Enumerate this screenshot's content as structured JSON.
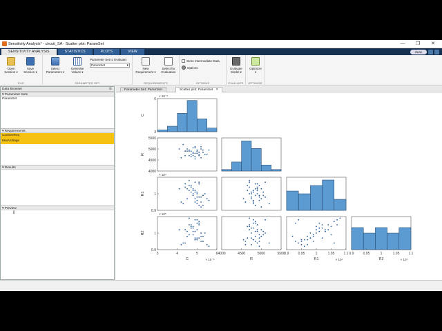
{
  "window": {
    "title": "Sensitivity Analysis* - circuit_SA - Scatter plot: ParamSet",
    "minimize_glyph": "—",
    "restore_glyph": "❐",
    "close_glyph": "✕"
  },
  "toolstrip_tabs": [
    {
      "label": "SENSITIVITY ANALYSIS",
      "active": true
    },
    {
      "label": "STATISTICS",
      "active": false
    },
    {
      "label": "PLOTS",
      "active": false
    },
    {
      "label": "VIEW",
      "active": false
    }
  ],
  "quick_access": {
    "chip_label": "clean"
  },
  "ribbon": {
    "file": {
      "group_name": "FILE",
      "open_label_1": "Open",
      "open_label_2": "Session ▾",
      "save_label_1": "Save",
      "save_label_2": "Session ▾"
    },
    "parameter_set": {
      "group_name": "PARAMETER SET",
      "select_params_1": "Select",
      "select_params_2": "Parameters ▾",
      "generate_values_1": "Generate",
      "generate_values_2": "Values ▾",
      "selector_label": "Parameter Set to Evaluate:",
      "selector_value": "ParamSet"
    },
    "requirements": {
      "group_name": "REQUIREMENTS",
      "new_req_1": "New",
      "new_req_2": "Requirement ▾",
      "select_eval_1": "Select for",
      "select_eval_2": "Evaluation"
    },
    "options": {
      "group_name": "OPTIONS",
      "store_label": "Store Intermediate Data",
      "options_label": "Options"
    },
    "evaluate": {
      "group_name": "EVALUATE",
      "eval_1": "Evaluate",
      "eval_2": "Model ▾"
    },
    "optimize": {
      "group_name": "OPTIMIZE",
      "opt_1": "Optimize",
      "opt_2": "▾"
    }
  },
  "data_browser": {
    "title": "Data Browser",
    "parameter_sets_header": "Parameter Sets",
    "parameter_sets": [
      "ParamSet"
    ],
    "requirements_header": "Requirements",
    "requirements": [
      "CustomReq",
      "MaxVoltage"
    ],
    "results_header": "Results",
    "preview_header": "Preview",
    "preview_value": "[]"
  },
  "doc_tabs": [
    {
      "label": "Parameter Set: ParamSet",
      "active": false
    },
    {
      "label": "Scatter plot: ParamSet",
      "active": true
    }
  ],
  "chart_data": {
    "type": "scatter",
    "variables": [
      "C",
      "R",
      "R1",
      "R2"
    ],
    "grid": false,
    "multipliers": {
      "C": "× 10⁻⁸",
      "R1": "× 10⁴",
      "R2": "× 10⁵"
    },
    "C_values": [
      4.2,
      4.6,
      5.1,
      4.9,
      5.3,
      4.4,
      4.8,
      5.0,
      5.6,
      4.7,
      5.2,
      4.5,
      4.9,
      5.1,
      5.4,
      4.3,
      4.8,
      5.0,
      4.6,
      5.2,
      4.9,
      5.3,
      4.7,
      5.5,
      4.1,
      5.0,
      4.8,
      4.6,
      5.1,
      4.9,
      5.2,
      4.4,
      5.0,
      4.7,
      5.3,
      4.8,
      4.5,
      5.1,
      4.9,
      5.0
    ],
    "R_values": [
      4600,
      4900,
      4750,
      5100,
      4850,
      4700,
      5050,
      4800,
      4950,
      4650,
      5000,
      4900,
      4550,
      4850,
      4750,
      5200,
      4800,
      4950,
      4700,
      4600,
      5050,
      4850,
      4900,
      4750,
      5000,
      4800,
      4700,
      4950,
      4850,
      4650,
      5100,
      4900,
      4800,
      4750,
      4950,
      4850,
      5000,
      4700,
      4800,
      4900
    ],
    "R1_values": [
      0.95,
      1.02,
      0.98,
      1.07,
      0.93,
      1.04,
      0.99,
      1.01,
      0.96,
      1.05,
      0.92,
      1.03,
      0.97,
      1.06,
      1.0,
      0.94,
      1.02,
      0.98,
      1.08,
      0.95,
      1.01,
      0.99,
      1.04,
      0.97,
      1.03,
      0.96,
      1.0,
      1.05,
      0.93,
      1.02,
      0.98,
      1.06,
      0.94,
      1.01,
      0.99,
      1.03,
      0.97,
      1.07,
      0.95,
      1.0
    ],
    "R2_values": [
      0.93,
      1.05,
      0.97,
      1.08,
      0.95,
      1.02,
      0.99,
      1.06,
      0.92,
      1.04,
      0.98,
      1.01,
      0.96,
      1.07,
      1.0,
      0.94,
      1.03,
      0.97,
      1.09,
      0.95,
      1.01,
      0.98,
      1.05,
      0.93,
      1.02,
      0.96,
      1.04,
      0.99,
      1.06,
      0.97,
      1.0,
      0.94,
      1.08,
      1.03,
      0.95,
      1.01,
      0.98,
      1.05,
      0.96,
      1.02
    ],
    "axes": {
      "C": {
        "range": [
          3,
          6
        ],
        "ticks": [
          3,
          4,
          5,
          6
        ],
        "hist_ticks": [
          3,
          4,
          5,
          6
        ]
      },
      "R": {
        "range": [
          4000,
          5500
        ],
        "ticks": [
          4000,
          4500,
          5000,
          5500
        ]
      },
      "R1": {
        "range": [
          0.9,
          1.1
        ],
        "ticks": [
          0.9,
          0.95,
          1,
          1.05,
          1.1
        ]
      },
      "R2": {
        "range": [
          0.9,
          1.1
        ],
        "ticks": [
          0.9,
          0.95,
          1,
          1.05,
          1.1
        ]
      }
    },
    "histograms": {
      "C": {
        "edges": [
          3.0,
          3.5,
          4.0,
          4.5,
          5.0,
          5.5,
          6.0
        ],
        "counts": [
          1,
          3,
          10,
          17,
          7,
          2
        ],
        "ylim": [
          0,
          18
        ]
      },
      "R": {
        "edges": [
          4000,
          4250,
          4500,
          4750,
          5000,
          5250,
          5500
        ],
        "counts": [
          1,
          6,
          20,
          15,
          4,
          1
        ],
        "ylim": [
          0,
          22
        ]
      },
      "R1": {
        "edges": [
          0.9,
          0.94,
          0.98,
          1.02,
          1.06,
          1.1
        ],
        "counts": [
          7,
          6,
          9,
          11,
          4
        ],
        "ylim": [
          0,
          12
        ]
      },
      "R2": {
        "edges": [
          0.9,
          0.94,
          0.98,
          1.02,
          1.06,
          1.1
        ],
        "counts": [
          8,
          6,
          8,
          6,
          8
        ],
        "ylim": [
          0,
          12
        ]
      }
    },
    "y_ticks": {
      "C": [
        3,
        6
      ],
      "R": [
        4000,
        4500,
        5000,
        5500
      ],
      "R1": [
        0.9,
        1
      ],
      "R2": [
        0.9,
        1
      ]
    },
    "colors": {
      "bar_fill": "#5b9bd1",
      "bar_edge": "#1f3f63",
      "point": "#2a5d9a"
    }
  }
}
